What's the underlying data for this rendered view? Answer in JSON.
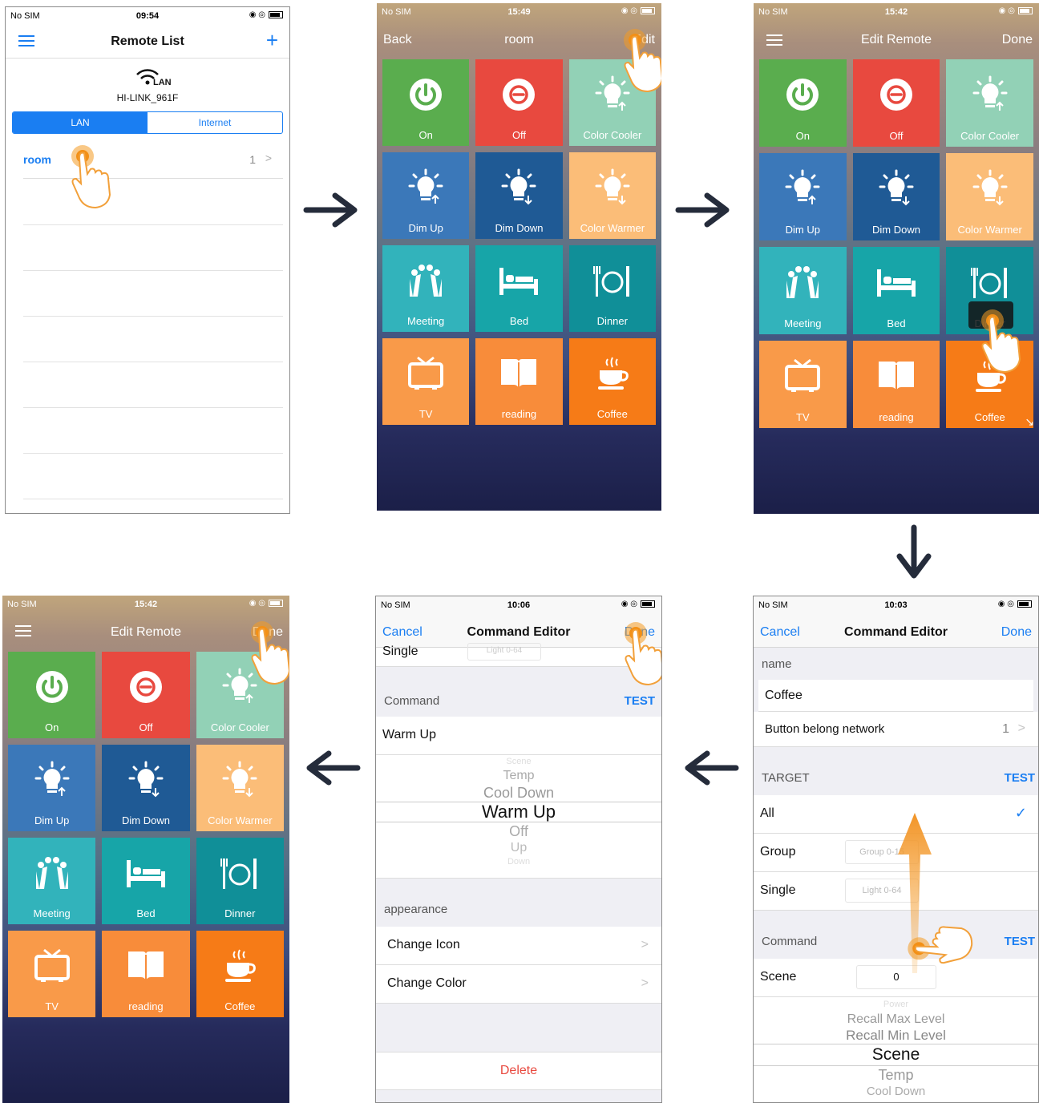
{
  "status": {
    "carrier": "No SIM",
    "t1": "09:54",
    "t2": "15:49",
    "t3": "15:42",
    "t4": "15:42",
    "t5": "10:06",
    "t6": "10:03"
  },
  "s1": {
    "title": "Remote List",
    "wifi_tag": "LAN",
    "device": "HI-LINK_961F",
    "seg": [
      "LAN",
      "Internet"
    ],
    "item_label": "room",
    "item_count": "1"
  },
  "s2": {
    "back": "Back",
    "title": "room",
    "edit": "Edit"
  },
  "s3": {
    "title": "Edit Remote",
    "done": "Done"
  },
  "s4": {
    "title": "Edit Remote",
    "done": "Done"
  },
  "tiles": [
    {
      "label": "On",
      "color": "#5aad4e",
      "icon": "power-icon"
    },
    {
      "label": "Off",
      "color": "#e8493f",
      "icon": "off-icon"
    },
    {
      "label": "Color Cooler",
      "color": "#92d1b6",
      "icon": "bulb-up-icon"
    },
    {
      "label": "Dim Up",
      "color": "#3b78b9",
      "icon": "bulb-up-icon"
    },
    {
      "label": "Dim Down",
      "color": "#1f5a95",
      "icon": "bulb-down-icon"
    },
    {
      "label": "Color Warmer",
      "color": "#fbbd78",
      "icon": "bulb-down-icon"
    },
    {
      "label": "Meeting",
      "color": "#32b3bb",
      "icon": "meeting-icon"
    },
    {
      "label": "Bed",
      "color": "#17a5a8",
      "icon": "bed-icon"
    },
    {
      "label": "Dinner",
      "color": "#108f98",
      "icon": "dinner-icon"
    },
    {
      "label": "TV",
      "color": "#f99a49",
      "icon": "tv-icon"
    },
    {
      "label": "reading",
      "color": "#f88c3a",
      "icon": "book-icon"
    },
    {
      "label": "Coffee",
      "color": "#f67b17",
      "icon": "coffee-icon"
    }
  ],
  "s5": {
    "cancel": "Cancel",
    "title": "Command Editor",
    "done": "Done",
    "top_row": "Single",
    "top_placeholder": "Light 0-64",
    "command_header": "Command",
    "test": "TEST",
    "command_value": "Warm Up",
    "picker": [
      "Scene",
      "Temp",
      "Cool Down",
      "Warm Up",
      "Off",
      "Up",
      "Down"
    ],
    "appearance_header": "appearance",
    "change_icon": "Change Icon",
    "change_color": "Change Color",
    "delete": "Delete"
  },
  "s6": {
    "cancel": "Cancel",
    "title": "Command Editor",
    "done": "Done",
    "name_header": "name",
    "name_value": "Coffee",
    "network_label": "Button belong network",
    "network_value": "1",
    "target_header": "TARGET",
    "test": "TEST",
    "all": "All",
    "group": "Group",
    "group_ph": "Group 0-15",
    "single": "Single",
    "single_ph": "Light 0-64",
    "command_header": "Command",
    "scene_label": "Scene",
    "scene_value": "0",
    "picker": [
      "Power",
      "Recall Max Level",
      "Recall Min Level",
      "Scene",
      "Temp",
      "Cool Down"
    ]
  }
}
